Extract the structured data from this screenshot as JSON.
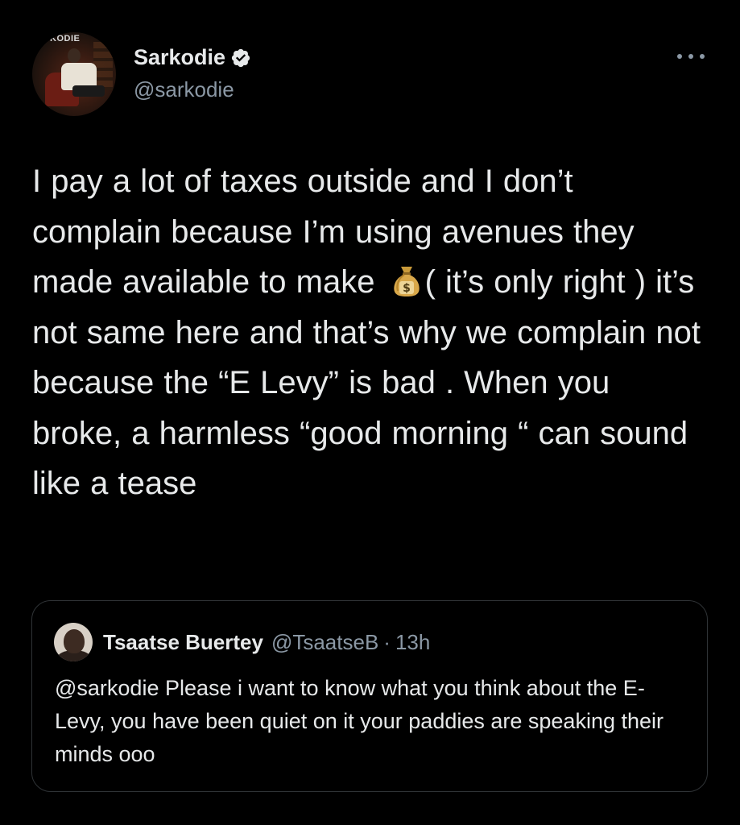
{
  "tweet": {
    "author": {
      "name": "Sarkodie",
      "handle": "@sarkodie",
      "verified": true,
      "avatar_logo_text": "KODIE"
    },
    "more_icon": "more-horizontal-icon",
    "text_before_emoji": "I pay a lot of taxes outside and I don’t complain because I’m using avenues they made available to make ",
    "emoji": "money-bag-icon",
    "text_after_emoji": "( it’s only right ) it’s not same here and that’s why we complain not because the “E Levy” is bad . When you broke, a harmless “good morning “ can sound like a tease"
  },
  "quoted_tweet": {
    "author_name": "Tsaatse Buertey",
    "author_handle": "@TsaatseB",
    "separator": "·",
    "time": "13h",
    "text": "@sarkodie Please i want to know what you think about the E-Levy, you have been quiet on it your paddies are speaking their minds ooo"
  },
  "colors": {
    "background": "#000000",
    "text_primary": "#e7e9ea",
    "text_secondary": "#8b98a5",
    "border": "#2f3336",
    "verified_badge": "#e7e9ea"
  }
}
